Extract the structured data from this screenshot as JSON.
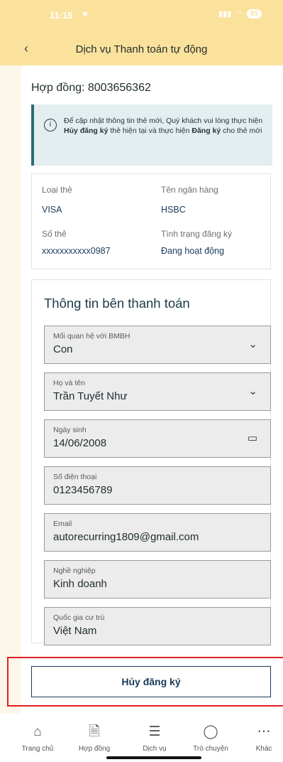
{
  "status_bar": {
    "time": "11:15",
    "battery": "95"
  },
  "nav": {
    "title": "Dịch vụ Thanh toán tự động"
  },
  "contract": {
    "label": "Hợp đồng: 8003656362"
  },
  "notice": {
    "part1": "Để cập nhật thông tin thẻ mới, Quý khách vui lòng thực hiện ",
    "bold1": "Hủy đăng ký",
    "part2": " thẻ hiện tại và thực hiện ",
    "bold2": "Đăng ký",
    "part3": " cho thẻ mới"
  },
  "card_info": {
    "card_type_label": "Loại thẻ",
    "card_type_value": "VISA",
    "bank_label": "Tên ngân hàng",
    "bank_value": "HSBC",
    "card_number_label": "Số thẻ",
    "card_number_value": "xxxxxxxxxxx0987",
    "status_label": "Tình trạng đăng ký",
    "status_value": "Đang hoạt động"
  },
  "payer": {
    "title": "Thông tin bên thanh toán",
    "fields": [
      {
        "label": "Mối quan hệ với BMBH",
        "value": "Con"
      },
      {
        "label": "Họ và tên",
        "value": "Trần Tuyết Như"
      },
      {
        "label": "Ngày sinh",
        "value": "14/06/2008"
      },
      {
        "label": "Số điện thoại",
        "value": "0123456789"
      },
      {
        "label": "Email",
        "value": "autorecurring1809@gmail.com"
      },
      {
        "label": "Nghề nghiệp",
        "value": "Kinh doanh"
      },
      {
        "label": "Quốc gia cư trú",
        "value": "Việt Nam"
      }
    ]
  },
  "actions": {
    "cancel_label": "Hủy đăng ký"
  },
  "tabbar": {
    "items": [
      {
        "label": "Trang chủ",
        "icon": "home-icon"
      },
      {
        "label": "Hợp đồng",
        "icon": "document-icon"
      },
      {
        "label": "Dịch vụ",
        "icon": "list-icon"
      },
      {
        "label": "Trò chuyện",
        "icon": "chat-icon"
      },
      {
        "label": "Khác",
        "icon": "more-icon"
      }
    ]
  },
  "colors": {
    "header_bg": "#fbe29c",
    "accent": "#1a3a5a",
    "highlight_border": "#e0201f"
  }
}
